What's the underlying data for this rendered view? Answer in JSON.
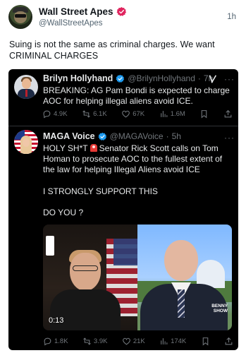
{
  "post": {
    "display_name": "Wall Street Apes",
    "handle": "@WallStreetApes",
    "time": "1h",
    "text": "Suing is not the same as criminal charges. We want CRIMINAL CHARGES",
    "verified_color": "#e0245e"
  },
  "quote1": {
    "display_name": "Brilyn Hollyhand",
    "handle": "@BrilynHollyhand",
    "separator": "·",
    "time": "7h",
    "text": "BREAKING: AG Pam Bondi is expected to charge AOC for helping illegal aliens avoid ICE.",
    "actions": {
      "replies": "4.9K",
      "reposts": "6.1K",
      "likes": "67K",
      "views": "1.6M"
    }
  },
  "quote2": {
    "display_name": "MAGA Voice",
    "handle": "@MAGAVoice",
    "separator": "·",
    "time": "5h",
    "text_lead": "HOLY SH*T",
    "text_rest": "Senator Rick Scott calls on Tom Homan to prosecute AOC to the fullest extent of the law for helping Illegal Aliens avoid ICE",
    "text_support": "I STRONGLY SUPPORT THIS",
    "text_question": "DO YOU ?",
    "video": {
      "duration": "0:13",
      "badge": "BENNY SHOW"
    },
    "actions": {
      "replies": "1.8K",
      "reposts": "3.9K",
      "likes": "21K",
      "views": "174K"
    }
  },
  "colors": {
    "verified_blue": "#1d9bf0",
    "card_bg": "#000000",
    "muted": "#71767b"
  }
}
